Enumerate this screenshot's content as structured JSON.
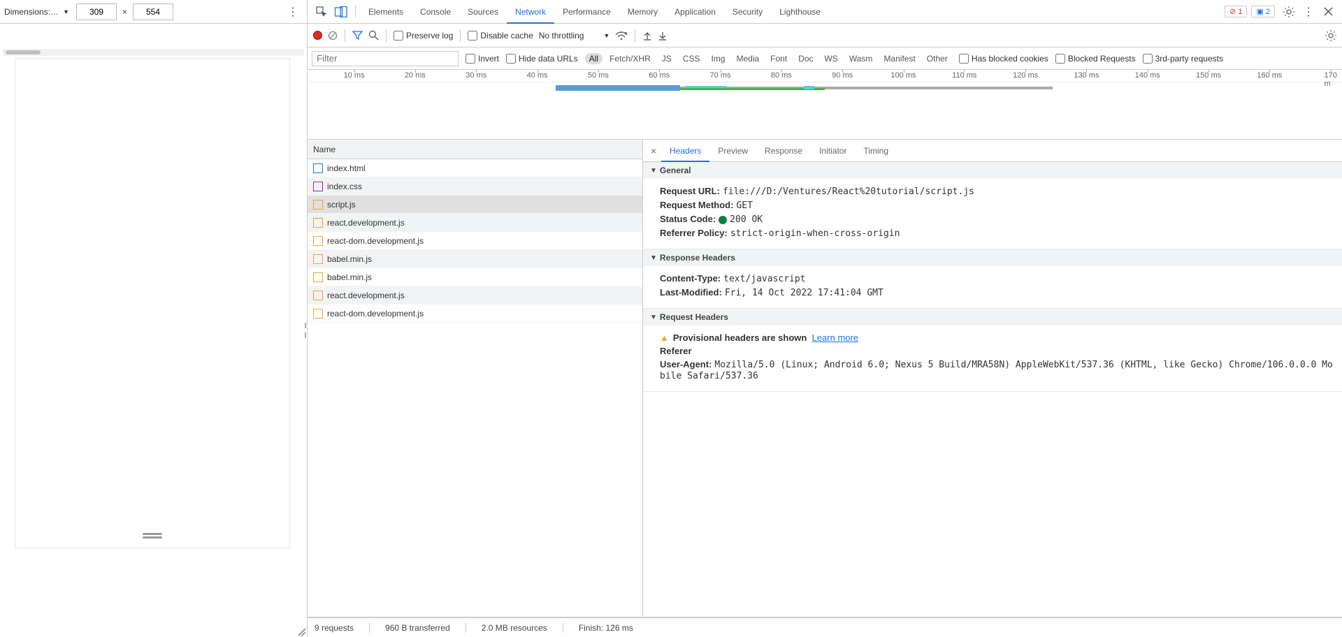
{
  "device": {
    "label": "Dimensions:…",
    "width": "309",
    "height": "554"
  },
  "tabs": [
    "Elements",
    "Console",
    "Sources",
    "Network",
    "Performance",
    "Memory",
    "Application",
    "Security",
    "Lighthouse"
  ],
  "active_tab": "Network",
  "badges": {
    "errors": "1",
    "info": "2"
  },
  "net_toolbar": {
    "preserve_log": "Preserve log",
    "disable_cache": "Disable cache",
    "throttle": "No throttling"
  },
  "filter": {
    "placeholder": "Filter",
    "invert": "Invert",
    "hide_data": "Hide data URLs",
    "types": [
      "All",
      "Fetch/XHR",
      "JS",
      "CSS",
      "Img",
      "Media",
      "Font",
      "Doc",
      "WS",
      "Wasm",
      "Manifest",
      "Other"
    ],
    "active_type": "All",
    "has_blocked": "Has blocked cookies",
    "blocked_req": "Blocked Requests",
    "third_party": "3rd-party requests"
  },
  "timeline": {
    "ticks": [
      "10 ms",
      "20 ms",
      "30 ms",
      "40 ms",
      "50 ms",
      "60 ms",
      "70 ms",
      "80 ms",
      "90 ms",
      "100 ms",
      "110 ms",
      "120 ms",
      "130 ms",
      "140 ms",
      "150 ms",
      "160 ms",
      "170 m"
    ]
  },
  "requests": {
    "header": "Name",
    "items": [
      {
        "name": "index.html",
        "type": "html"
      },
      {
        "name": "index.css",
        "type": "css"
      },
      {
        "name": "script.js",
        "type": "js",
        "selected": true
      },
      {
        "name": "react.development.js",
        "type": "js"
      },
      {
        "name": "react-dom.development.js",
        "type": "js"
      },
      {
        "name": "babel.min.js",
        "type": "js"
      },
      {
        "name": "babel.min.js",
        "type": "js"
      },
      {
        "name": "react.development.js",
        "type": "js"
      },
      {
        "name": "react-dom.development.js",
        "type": "js"
      }
    ]
  },
  "detail_tabs": [
    "Headers",
    "Preview",
    "Response",
    "Initiator",
    "Timing"
  ],
  "active_detail_tab": "Headers",
  "sections": {
    "general": {
      "title": "General",
      "request_url_k": "Request URL:",
      "request_url_v": "file:///D:/Ventures/React%20tutorial/script.js",
      "method_k": "Request Method:",
      "method_v": "GET",
      "status_k": "Status Code:",
      "status_v": "200 OK",
      "ref_k": "Referrer Policy:",
      "ref_v": "strict-origin-when-cross-origin"
    },
    "response": {
      "title": "Response Headers",
      "ct_k": "Content-Type:",
      "ct_v": "text/javascript",
      "lm_k": "Last-Modified:",
      "lm_v": "Fri, 14 Oct 2022 17:41:04 GMT"
    },
    "request": {
      "title": "Request Headers",
      "provisional": "Provisional headers are shown",
      "learn": "Learn more",
      "referer_k": "Referer",
      "ua_k": "User-Agent:",
      "ua_v": "Mozilla/5.0 (Linux; Android 6.0; Nexus 5 Build/MRA58N) AppleWebKit/537.36 (KHTML, like Gecko) Chrome/106.0.0.0 Mobile Safari/537.36"
    }
  },
  "status": {
    "requests": "9 requests",
    "transferred": "960 B transferred",
    "resources": "2.0 MB resources",
    "finish": "Finish: 126 ms"
  }
}
